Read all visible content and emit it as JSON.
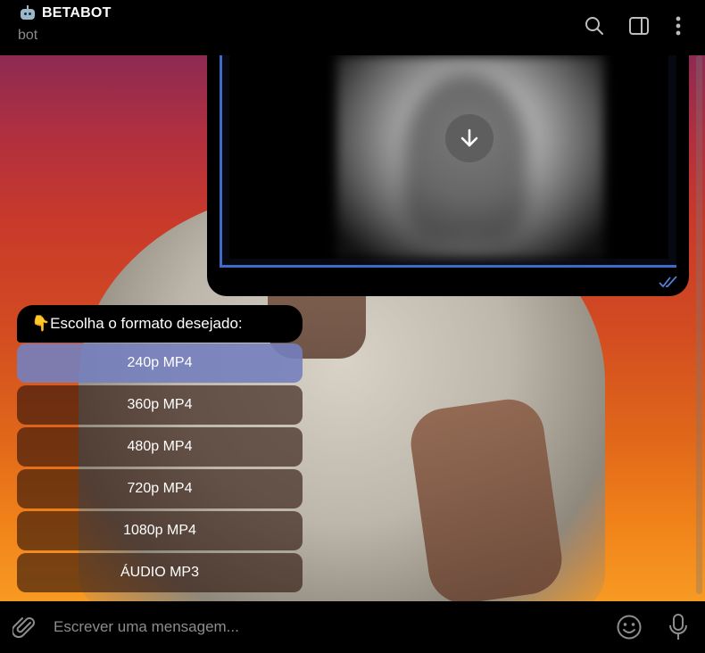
{
  "header": {
    "title": "BETABOT",
    "subtitle": "bot",
    "icons": [
      "search-icon",
      "sidebar-toggle-icon",
      "more-vertical-icon"
    ]
  },
  "video_message": {
    "download_icon": "download-arrow-icon",
    "status_icon": "double-check-icon"
  },
  "keyboard": {
    "prompt": "👇Escolha o formato desejado:",
    "buttons": [
      {
        "label": "240p MP4"
      },
      {
        "label": "360p MP4"
      },
      {
        "label": "480p MP4"
      },
      {
        "label": "720p MP4"
      },
      {
        "label": "1080p MP4"
      },
      {
        "label": "ÁUDIO MP3"
      }
    ]
  },
  "composer": {
    "placeholder": "Escrever uma mensagem...",
    "icons": [
      "paperclip-icon",
      "emoji-icon",
      "microphone-icon"
    ]
  },
  "colors": {
    "accent": "#3e6ac8",
    "selected_button": "#7480be"
  }
}
